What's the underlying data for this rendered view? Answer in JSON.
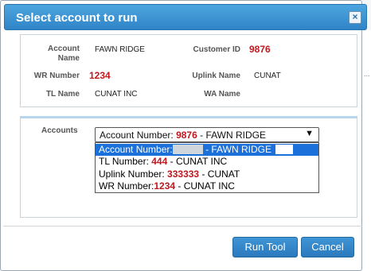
{
  "dialog": {
    "title": "Select account to run",
    "close_glyph": "×"
  },
  "info": {
    "account_name_label": "Account Name",
    "account_name_value": "FAWN RIDGE",
    "customer_id_label": "Customer ID",
    "customer_id_value": "9876",
    "wr_number_label": "WR Number",
    "wr_number_value": "1234",
    "uplink_name_label": "Uplink Name",
    "uplink_name_value": "CUNAT",
    "tl_name_label": "TL Name",
    "tl_name_value": "CUNAT INC",
    "wa_name_label": "WA Name",
    "wa_name_value": ""
  },
  "accounts": {
    "label": "Accounts",
    "selected": {
      "prefix": "Account Number:",
      "number": "9876",
      "suffix": "- FAWN RIDGE"
    },
    "arrow": "▼",
    "options": [
      {
        "prefix": "Account Number:",
        "number": "",
        "suffix": "- FAWN RIDGE",
        "selected": true
      },
      {
        "prefix": "TL Number:",
        "number": "444",
        "suffix": "- CUNAT INC",
        "selected": false
      },
      {
        "prefix": "Uplink Number:",
        "number": "333333",
        "suffix": "- CUNAT",
        "selected": false
      },
      {
        "prefix": "WR Number:",
        "number": "1234",
        "suffix": "- CUNAT INC",
        "selected": false
      }
    ]
  },
  "buttons": {
    "run_tool": "Run Tool",
    "cancel": "Cancel"
  },
  "colors": {
    "title_bar": "#2f84c6",
    "highlight": "#1c70d9",
    "value_red": "#c0181e"
  }
}
